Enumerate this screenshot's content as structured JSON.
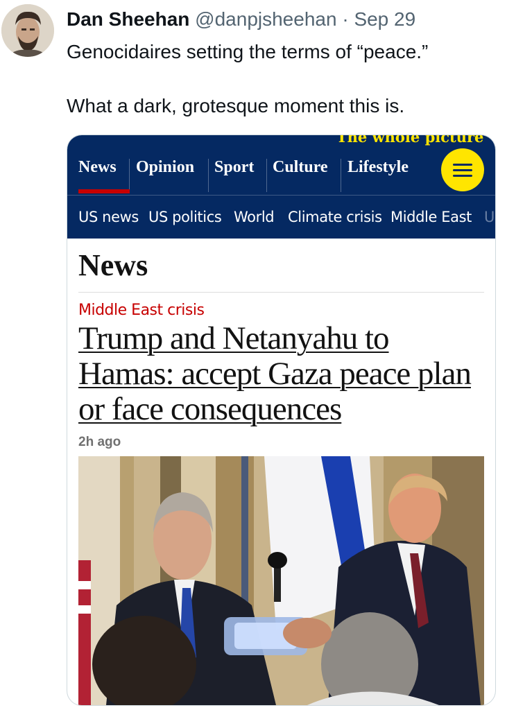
{
  "tweet": {
    "author_name": "Dan Sheehan",
    "handle": "@danpjsheehan",
    "separator": "·",
    "date": "Sep 29",
    "text_line1": "Genocidaires setting the terms of “peace.”",
    "text_line2": "What a dark, grotesque moment this is."
  },
  "article_card": {
    "tagline": "The whole picture",
    "pillars": [
      {
        "label": "News"
      },
      {
        "label": "Opinion"
      },
      {
        "label": "Sport"
      },
      {
        "label": "Culture"
      },
      {
        "label": "Lifestyle"
      }
    ],
    "menu_icon": "hamburger-menu-icon",
    "subnav": [
      "US news",
      "US politics",
      "World",
      "Climate crisis",
      "Middle East",
      "U"
    ],
    "section_title": "News",
    "kicker": "Middle East crisis",
    "headline": "Trump and Netanyahu to Hamas: accept Gaza peace plan or face consequences",
    "timestamp": "2h ago",
    "colors": {
      "brand_blue": "#052962",
      "accent_yellow": "#ffe500",
      "kicker_red": "#c70000"
    }
  }
}
